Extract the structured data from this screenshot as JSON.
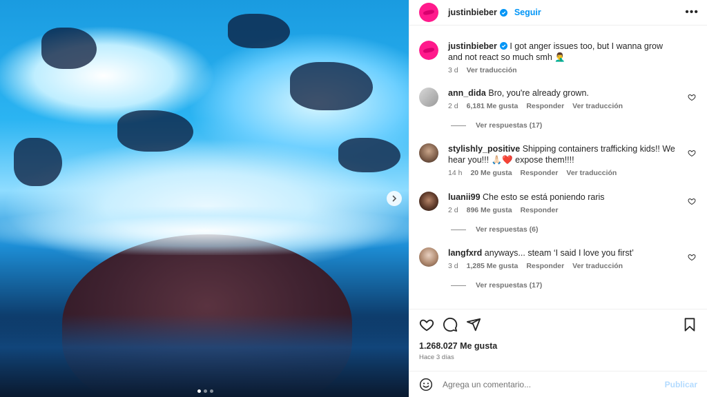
{
  "post": {
    "username": "justinbieber",
    "follow_label": "Seguir",
    "more_label": "•••",
    "brand_color": "#ff1a8c",
    "caption": {
      "text": "I got anger issues too, but I wanna grow and not react so much smh 🤦‍♂️",
      "time": "3 d",
      "translate": "Ver traducción"
    },
    "carousel": {
      "slides": 3,
      "current": 1
    }
  },
  "comments": [
    {
      "user": "ann_dida",
      "text": "Bro, you're already grown.",
      "time": "2 d",
      "likes": "6,181 Me gusta",
      "reply": "Responder",
      "translate": "Ver traducción",
      "replies": "Ver respuestas (17)"
    },
    {
      "user": "stylishly_positive",
      "text": "Shipping containers trafficking kids!! We hear you!!! 🙏🏻❤️ expose them!!!!",
      "time": "14 h",
      "likes": "20 Me gusta",
      "reply": "Responder",
      "translate": "Ver traducción",
      "replies": ""
    },
    {
      "user": "luanii99",
      "text": "Che esto se está poniendo raris",
      "time": "2 d",
      "likes": "896 Me gusta",
      "reply": "Responder",
      "translate": "",
      "replies": "Ver respuestas (6)"
    },
    {
      "user": "langfxrd",
      "text": "anyways... steam ‘I said I love you first’",
      "time": "3 d",
      "likes": "1,285 Me gusta",
      "reply": "Responder",
      "translate": "Ver traducción",
      "replies": "Ver respuestas (17)"
    }
  ],
  "footer": {
    "likes": "1.268.027 Me gusta",
    "posted": "Hace 3 días",
    "comment_placeholder": "Agrega un comentario...",
    "publish_label": "Publicar"
  }
}
